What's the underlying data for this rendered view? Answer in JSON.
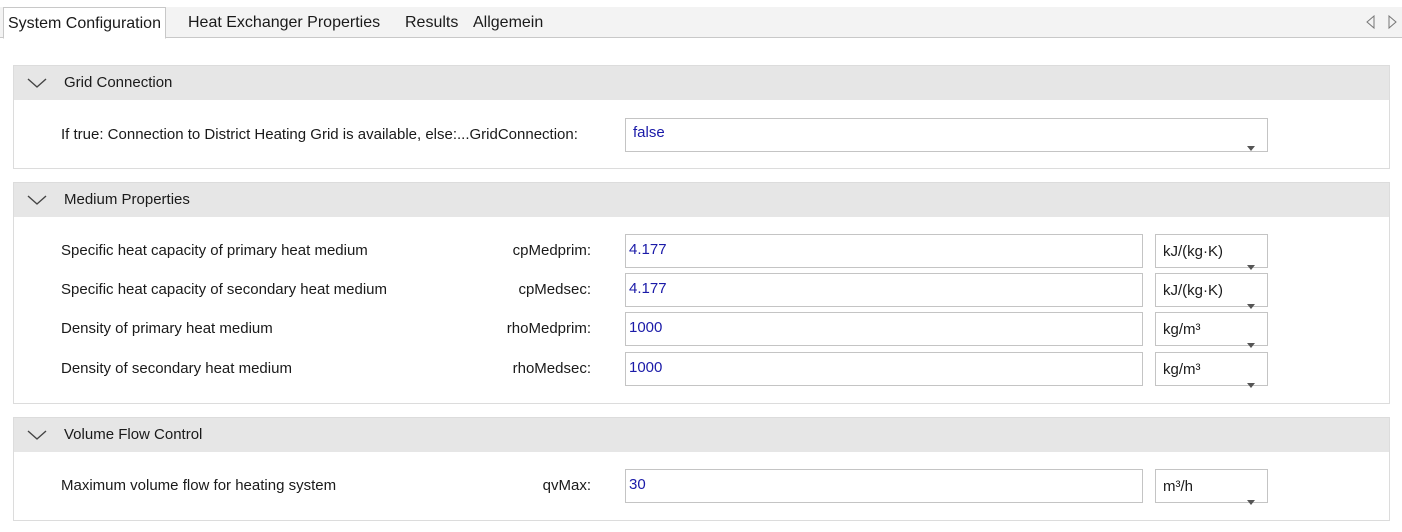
{
  "tabs": [
    {
      "label": "System Configuration"
    },
    {
      "label": "Heat Exchanger Properties"
    },
    {
      "label": "Results"
    },
    {
      "label": "Allgemein"
    }
  ],
  "icons": {
    "scroll_left": "triangle-left-icon",
    "scroll_right": "triangle-right-icon",
    "collapse": "chevron-down-icon",
    "dropdown": "caret-down-icon"
  },
  "colors": {
    "value_text": "#1a1aa8",
    "header_bg": "#e6e6e6"
  },
  "sections": {
    "grid": {
      "title": "Grid Connection",
      "rows": [
        {
          "description": "If true: Connection to District Heating Grid is available, else:...GridConnection:",
          "value": "false"
        }
      ]
    },
    "medium": {
      "title": "Medium Properties",
      "rows": [
        {
          "description": "Specific heat capacity of primary heat medium",
          "param": "cpMedprim:",
          "value": "4.177",
          "unit": "kJ/(kg·K)"
        },
        {
          "description": "Specific heat capacity of secondary heat medium",
          "param": "cpMedsec:",
          "value": "4.177",
          "unit": "kJ/(kg·K)"
        },
        {
          "description": "Density of primary heat medium",
          "param": "rhoMedprim:",
          "value": "1000",
          "unit": "kg/m³"
        },
        {
          "description": "Density of secondary heat medium",
          "param": "rhoMedsec:",
          "value": "1000",
          "unit": "kg/m³"
        }
      ]
    },
    "volume": {
      "title": "Volume Flow Control",
      "rows": [
        {
          "description": "Maximum volume flow for heating system",
          "param": "qvMax:",
          "value": "30",
          "unit": "m³/h"
        }
      ]
    }
  }
}
